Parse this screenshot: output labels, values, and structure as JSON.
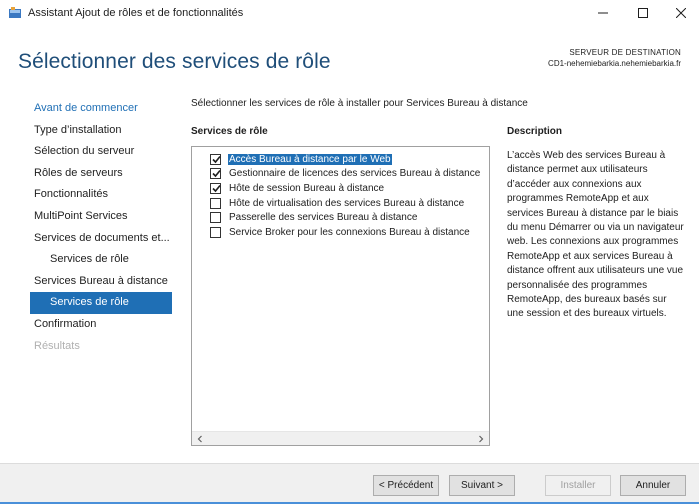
{
  "window": {
    "title": "Assistant Ajout de rôles et de fonctionnalités",
    "minimize": "—",
    "maximize": "☐",
    "close": "✕"
  },
  "header": {
    "page_title": "Sélectionner des services de rôle",
    "destination_label": "SERVEUR DE DESTINATION",
    "destination_server": "CD1-nehemiebarkia.nehemiebarkia.fr"
  },
  "nav": {
    "items": [
      {
        "label": "Avant de commencer",
        "state": "link"
      },
      {
        "label": "Type d’installation",
        "state": "normal"
      },
      {
        "label": "Sélection du serveur",
        "state": "normal"
      },
      {
        "label": "Rôles de serveurs",
        "state": "normal"
      },
      {
        "label": "Fonctionnalités",
        "state": "normal"
      },
      {
        "label": "MultiPoint Services",
        "state": "normal"
      },
      {
        "label": "Services de documents et...",
        "state": "normal"
      },
      {
        "label": "Services de rôle",
        "state": "sub"
      },
      {
        "label": "Services Bureau à distance",
        "state": "normal"
      },
      {
        "label": "Services de rôle",
        "state": "active"
      },
      {
        "label": "Confirmation",
        "state": "normal"
      },
      {
        "label": "Résultats",
        "state": "disabled"
      }
    ]
  },
  "main": {
    "intro": "Sélectionner les services de rôle à installer pour Services Bureau à distance",
    "roles_heading": "Services de rôle",
    "description_heading": "Description",
    "roles": [
      {
        "label": "Accès Bureau à distance par le Web",
        "checked": true,
        "selected": true
      },
      {
        "label": "Gestionnaire de licences des services Bureau à distance",
        "checked": true,
        "selected": false
      },
      {
        "label": "Hôte de session Bureau à distance",
        "checked": true,
        "selected": false
      },
      {
        "label": "Hôte de virtualisation des services Bureau à distance",
        "checked": false,
        "selected": false
      },
      {
        "label": "Passerelle des services Bureau à distance",
        "checked": false,
        "selected": false
      },
      {
        "label": "Service Broker pour les connexions Bureau à distance",
        "checked": false,
        "selected": false
      }
    ],
    "scroll_left": "<",
    "scroll_right": ">",
    "description": "L’accès Web des services Bureau à distance permet aux utilisateurs d’accéder aux connexions aux programmes RemoteApp et aux services Bureau à distance par le biais du menu Démarrer ou via un navigateur web. Les connexions aux programmes RemoteApp et aux services Bureau à distance offrent aux utilisateurs une vue personnalisée des programmes RemoteApp, des bureaux basés sur une session et des bureaux virtuels."
  },
  "footer": {
    "previous": "< Précédent",
    "next": "Suivant >",
    "install": "Installer",
    "cancel": "Annuler"
  },
  "colors": {
    "accent": "#1f6fb5",
    "title": "#1f4e79",
    "disabled": "#b0b0b0"
  }
}
